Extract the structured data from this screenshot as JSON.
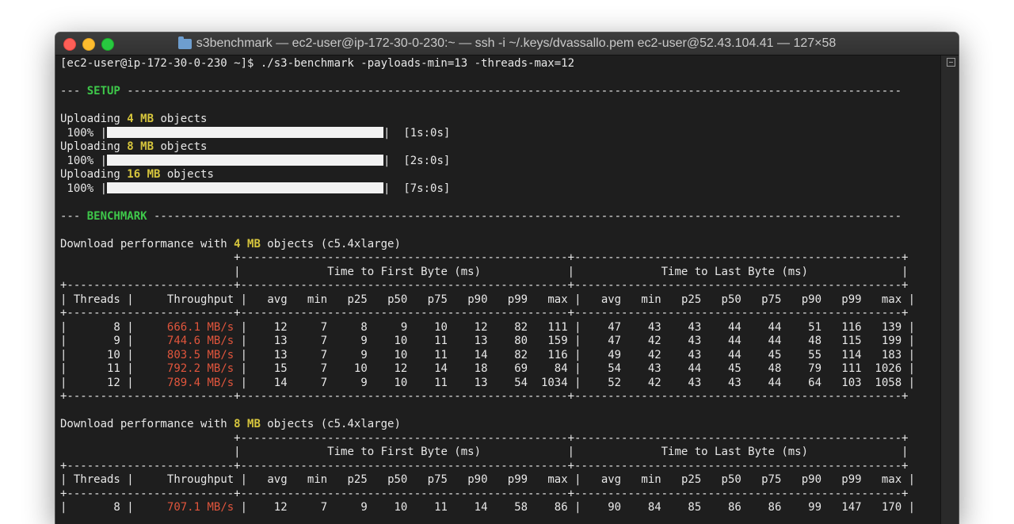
{
  "window": {
    "title": "s3benchmark — ec2-user@ip-172-30-0-230:~ — ssh -i ~/.keys/dvassallo.pem ec2-user@52.43.104.41 — 127×58"
  },
  "terminal": {
    "prompt_line": "[ec2-user@ip-172-30-0-230 ~]$ ./s3-benchmark -payloads-min=13 -threads-max=12",
    "setup": {
      "label": "SETUP",
      "uploads": [
        {
          "prefix": "Uploading ",
          "size": "4 MB",
          "suffix": " objects",
          "percent": "100%",
          "time": "[1s:0s]",
          "progress": 1.0
        },
        {
          "prefix": "Uploading ",
          "size": "8 MB",
          "suffix": " objects",
          "percent": "100%",
          "time": "[2s:0s]",
          "progress": 1.0
        },
        {
          "prefix": "Uploading ",
          "size": "16 MB",
          "suffix": " objects",
          "percent": "100%",
          "time": "[7s:0s]",
          "progress": 1.0
        }
      ]
    },
    "benchmark_label": "BENCHMARK",
    "tables": [
      {
        "heading_prefix": "Download performance with ",
        "size": "4 MB",
        "heading_suffix": " objects (c5.4xlarge)",
        "group1": "Time to First Byte (ms)",
        "group2": "Time to Last Byte (ms)",
        "columns": [
          "Threads",
          "Throughput",
          "avg",
          "min",
          "p25",
          "p50",
          "p75",
          "p90",
          "p99",
          "max",
          "avg",
          "min",
          "p25",
          "p50",
          "p75",
          "p90",
          "p99",
          "max"
        ],
        "rows": [
          {
            "threads": "8",
            "throughput": "666.1 MB/s",
            "ttfb": [
              "12",
              "7",
              "8",
              "9",
              "10",
              "12",
              "82",
              "111"
            ],
            "ttlb": [
              "47",
              "43",
              "43",
              "44",
              "44",
              "51",
              "116",
              "139"
            ]
          },
          {
            "threads": "9",
            "throughput": "744.6 MB/s",
            "ttfb": [
              "13",
              "7",
              "9",
              "10",
              "11",
              "13",
              "80",
              "159"
            ],
            "ttlb": [
              "47",
              "42",
              "43",
              "44",
              "44",
              "48",
              "115",
              "199"
            ]
          },
          {
            "threads": "10",
            "throughput": "803.5 MB/s",
            "ttfb": [
              "13",
              "7",
              "9",
              "10",
              "11",
              "14",
              "82",
              "116"
            ],
            "ttlb": [
              "49",
              "42",
              "43",
              "44",
              "45",
              "55",
              "114",
              "183"
            ]
          },
          {
            "threads": "11",
            "throughput": "792.2 MB/s",
            "ttfb": [
              "15",
              "7",
              "10",
              "12",
              "14",
              "18",
              "69",
              "84"
            ],
            "ttlb": [
              "54",
              "43",
              "44",
              "45",
              "48",
              "79",
              "111",
              "1026"
            ]
          },
          {
            "threads": "12",
            "throughput": "789.4 MB/s",
            "ttfb": [
              "14",
              "7",
              "9",
              "10",
              "11",
              "13",
              "54",
              "1034"
            ],
            "ttlb": [
              "52",
              "42",
              "43",
              "43",
              "44",
              "64",
              "103",
              "1058"
            ]
          }
        ]
      },
      {
        "heading_prefix": "Download performance with ",
        "size": "8 MB",
        "heading_suffix": " objects (c5.4xlarge)",
        "group1": "Time to First Byte (ms)",
        "group2": "Time to Last Byte (ms)",
        "columns": [
          "Threads",
          "Throughput",
          "avg",
          "min",
          "p25",
          "p50",
          "p75",
          "p90",
          "p99",
          "max",
          "avg",
          "min",
          "p25",
          "p50",
          "p75",
          "p90",
          "p99",
          "max"
        ],
        "rows": [
          {
            "threads": "8",
            "throughput": "707.1 MB/s",
            "ttfb": [
              "12",
              "7",
              "9",
              "10",
              "11",
              "14",
              "58",
              "86"
            ],
            "ttlb": [
              "90",
              "84",
              "85",
              "86",
              "86",
              "99",
              "147",
              "170"
            ]
          }
        ]
      }
    ]
  },
  "colors": {
    "background": "#1e1e1e",
    "text": "#e8e8e8",
    "label_green": "#3ec74a",
    "size_yellow": "#d7c63d",
    "throughput_red": "#e0553c"
  }
}
